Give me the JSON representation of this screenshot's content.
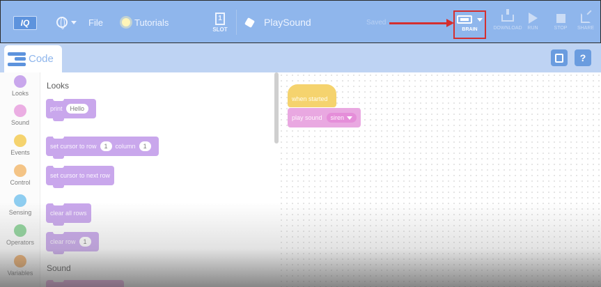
{
  "menubar": {
    "logo": "IQ",
    "file": "File",
    "tutorials": "Tutorials",
    "slot_number": "1",
    "slot_label": "SLOT",
    "project_name": "PlaySound",
    "save_status": "Saved",
    "buttons": {
      "brain": "BRAIN",
      "download": "DOWNLOAD",
      "run": "RUN",
      "stop": "STOP",
      "share": "SHARE"
    },
    "highlight_color": "#d42f2f"
  },
  "tabbar": {
    "code_tab": "Code",
    "help": "?"
  },
  "categories": [
    {
      "label": "Looks",
      "color": "#c9a7ec"
    },
    {
      "label": "Sound",
      "color": "#ebaee3"
    },
    {
      "label": "Events",
      "color": "#f5d36e"
    },
    {
      "label": "Control",
      "color": "#f4c486"
    },
    {
      "label": "Sensing",
      "color": "#8ecdf0"
    },
    {
      "label": "Operators",
      "color": "#8fd49a"
    },
    {
      "label": "Variables",
      "color": "#f0b06e"
    }
  ],
  "flyout": {
    "section_looks": "Looks",
    "section_sound": "Sound",
    "blocks": {
      "print": "print",
      "print_value": "Hello",
      "set_cursor_row": "set cursor to row",
      "set_cursor_row_value": "1",
      "set_cursor_column": "column",
      "set_cursor_column_value": "1",
      "next_row": "set cursor to next row",
      "clear_all_rows": "clear all rows",
      "clear_row": "clear row",
      "clear_row_value": "1"
    }
  },
  "workspace": {
    "hat_block": "when started",
    "play_sound": "play sound",
    "sound_option": "siren"
  }
}
